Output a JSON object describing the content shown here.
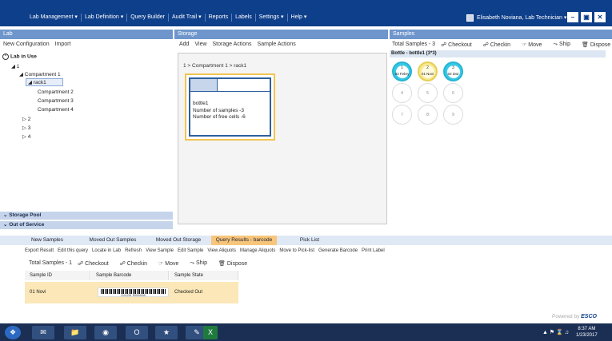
{
  "menu": [
    "Lab Management ▾",
    "Lab Definition ▾",
    "Query Builder",
    "Audit Trail ▾",
    "Reports",
    "Labels",
    "Settings ▾",
    "Help ▾"
  ],
  "user": {
    "name": "Elisabeth Noviana, Lab Technician ▾"
  },
  "window_controls": [
    "–",
    "▣",
    "✕"
  ],
  "lab": {
    "header": "Lab",
    "toolbar": [
      "New Configuration",
      "Import"
    ],
    "lab_in_use": "Lab in Use",
    "tree": [
      "◢ 1",
      "◢ Compartment 1",
      "◢ rack1",
      "Compartment 2",
      "Compartment 3",
      "Compartment 4",
      "▷ 2",
      "▷ 3",
      "▷ 4"
    ],
    "storage_pool": "Storage Pool",
    "out_of_service": "Out of Service"
  },
  "storage": {
    "header": "Storage",
    "toolbar": [
      "Add",
      "View",
      "Storage Actions",
      "Sample Actions"
    ],
    "path": "1 > Compartment 1 > rack1",
    "item_name": "bottle1",
    "item_samples": "Number of samples -3",
    "item_free": "Number of free cells -6"
  },
  "samples": {
    "header": "Samples",
    "toolbar": [
      "Total Samples - 3",
      "Checkout",
      "Checkin",
      "Move",
      "Ship",
      "Dispose"
    ],
    "bottle_title": "Bottle - bottle1 (3*3)",
    "cells": [
      {
        "num": "1",
        "label": "03 Febry",
        "state": "filled"
      },
      {
        "num": "2",
        "label": "01 Novi",
        "state": "highlighted"
      },
      {
        "num": "3",
        "label": "02 Dwi",
        "state": "filled"
      },
      {
        "num": "4",
        "label": "",
        "state": "empty"
      },
      {
        "num": "5",
        "label": "",
        "state": "empty"
      },
      {
        "num": "6",
        "label": "",
        "state": "empty"
      },
      {
        "num": "7",
        "label": "",
        "state": "empty"
      },
      {
        "num": "8",
        "label": "",
        "state": "empty"
      },
      {
        "num": "9",
        "label": "",
        "state": "empty"
      }
    ]
  },
  "bottom": {
    "tabs": [
      "New Samples",
      "Moved Out Samples",
      "Moved Out Storage",
      "Query Results - barcode",
      "Pick List"
    ],
    "active_tab": 3,
    "actions": [
      "Export Result",
      "Edit this query",
      "Locate in Lab",
      "Refresh",
      "View Sample",
      "Edit Sample",
      "View Aliquots",
      "Manage Aliquots",
      "Move to Pick-list",
      "Generate Barcode",
      "Print Label"
    ],
    "toolbar": [
      "Total Samples - 1",
      "Checkout",
      "Checkin",
      "Move",
      "Ship",
      "Dispose"
    ],
    "columns": [
      "Sample ID",
      "Sample Barcode",
      "Sample State"
    ],
    "rows": [
      {
        "id": "01 Novi",
        "barcode_text": "2101201 R0000005",
        "state": "Checked Out"
      }
    ]
  },
  "footer": {
    "powered_by": "Powered by",
    "brand": "ESCO"
  },
  "taskbar": {
    "time": "8:37 AM",
    "date": "1/23/2017"
  },
  "colors": {
    "accent": "#0e3f8a",
    "pane_header": "#6f96cc",
    "selection_yellow": "#f7c57b",
    "cell_cyan": "#36c9e6"
  }
}
